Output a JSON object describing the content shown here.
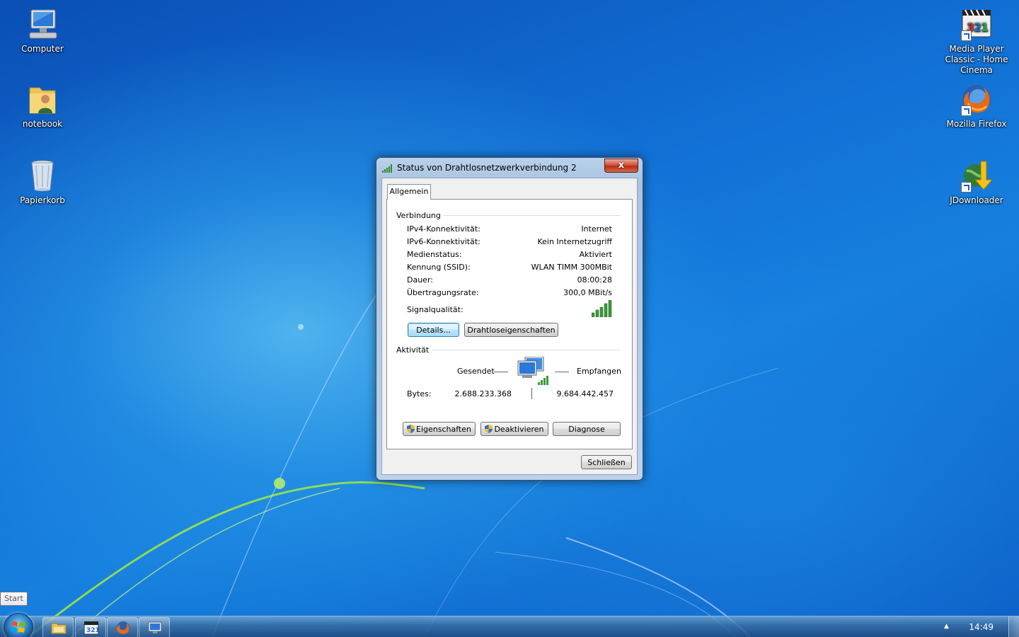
{
  "desktop": {
    "icons_left": [
      {
        "label": "Computer",
        "icon": "computer-icon"
      },
      {
        "label": "notebook",
        "icon": "user-folder-icon"
      },
      {
        "label": "Papierkorb",
        "icon": "recycle-bin-icon"
      }
    ],
    "icons_right": [
      {
        "label": "Media Player Classic - Home Cinema",
        "icon": "media-player-classic-icon"
      },
      {
        "label": "Mozilla Firefox",
        "icon": "firefox-icon"
      },
      {
        "label": "JDownloader",
        "icon": "jdownloader-icon"
      }
    ]
  },
  "dialog": {
    "title": "Status von Drahtlosnetzwerkverbindung 2",
    "close_label": "x",
    "tab_label": "Allgemein",
    "connection_group": "Verbindung",
    "rows": [
      {
        "key": "IPv4-Konnektivität:",
        "value": "Internet"
      },
      {
        "key": "IPv6-Konnektivität:",
        "value": "Kein Internetzugriff"
      },
      {
        "key": "Medienstatus:",
        "value": "Aktiviert"
      },
      {
        "key": "Kennung (SSID):",
        "value": "WLAN TIMM 300MBit"
      },
      {
        "key": "Dauer:",
        "value": "08:00:28"
      },
      {
        "key": "Übertragungsrate:",
        "value": "300,0 MBit/s"
      }
    ],
    "signal_label": "Signalqualität:",
    "signal_bars": 5,
    "details_button": "Details...",
    "wireless_props_button": "Drahtloseigenschaften",
    "activity_group": "Aktivität",
    "sent_label": "Gesendet",
    "received_label": "Empfangen",
    "bytes_label": "Bytes:",
    "bytes_sent": "2.688.233.368",
    "bytes_received": "9.684.442.457",
    "properties_button": "Eigenschaften",
    "disable_button": "Deaktivieren",
    "diagnose_button": "Diagnose",
    "close_button": "Schließen"
  },
  "taskbar": {
    "tooltip": "Start",
    "pinned": [
      "explorer-icon",
      "media-player-icon",
      "firefox-icon",
      "network-icon"
    ],
    "clock": "14:49",
    "tray_arrow": "▲"
  },
  "colors": {
    "desktop_blue": "#1271d6",
    "close_red": "#c4391f",
    "signal_green": "#2e8b2e"
  }
}
